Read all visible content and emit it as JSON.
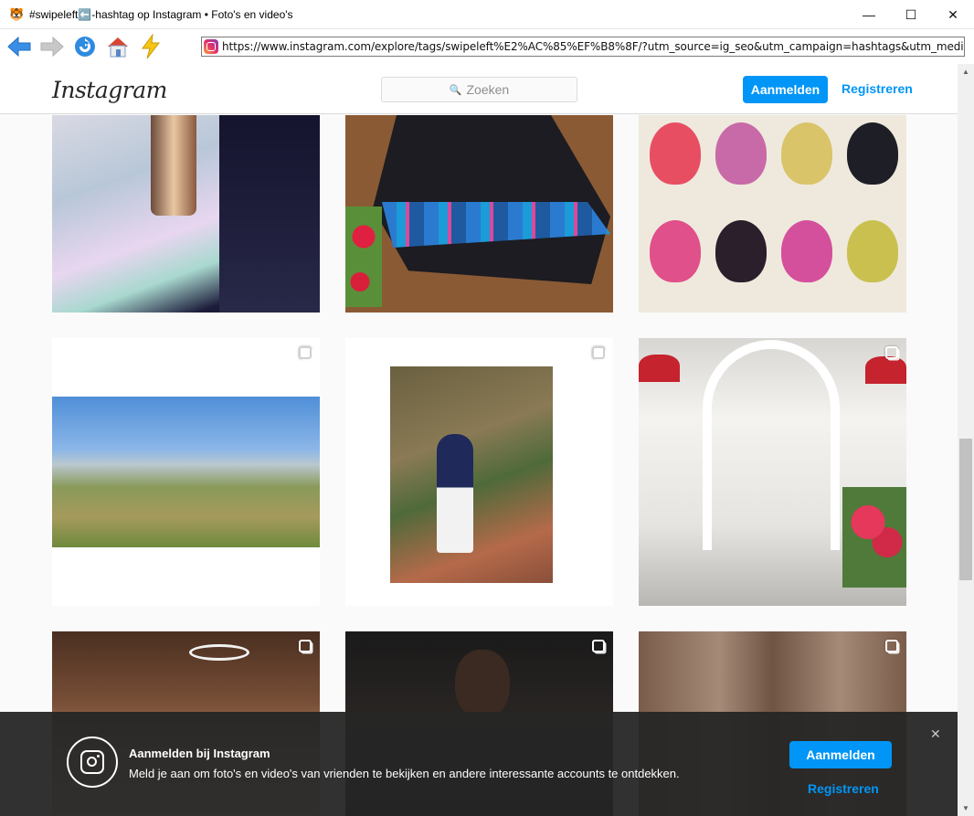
{
  "window": {
    "title": "#swipeleft⬅️-hashtag op Instagram • Foto's en video's",
    "minimize": "—",
    "maximize": "☐",
    "close": "✕"
  },
  "browser": {
    "url": "https://www.instagram.com/explore/tags/swipeleft%E2%AC%85%EF%B8%8F/?utm_source=ig_seo&utm_campaign=hashtags&utm_mediu"
  },
  "header": {
    "logo": "Instagram",
    "search_placeholder": "Zoeken",
    "login_label": "Aanmelden",
    "register_label": "Registreren"
  },
  "banner": {
    "title": "Aanmelden bij Instagram",
    "text": "Meld je aan om foto's en video's van vrienden te bekijken en andere interessante accounts te ontdekken.",
    "login_label": "Aanmelden",
    "register_label": "Registreren",
    "close": "✕"
  },
  "colors": {
    "accent": "#0095f6",
    "banner_bg": "#262626",
    "border": "#dbdbdb"
  },
  "icons": {
    "back": "back-arrow-icon",
    "forward": "forward-arrow-icon",
    "refresh": "refresh-icon",
    "home": "home-icon",
    "bolt": "lightning-icon",
    "multi": "carousel-icon"
  }
}
